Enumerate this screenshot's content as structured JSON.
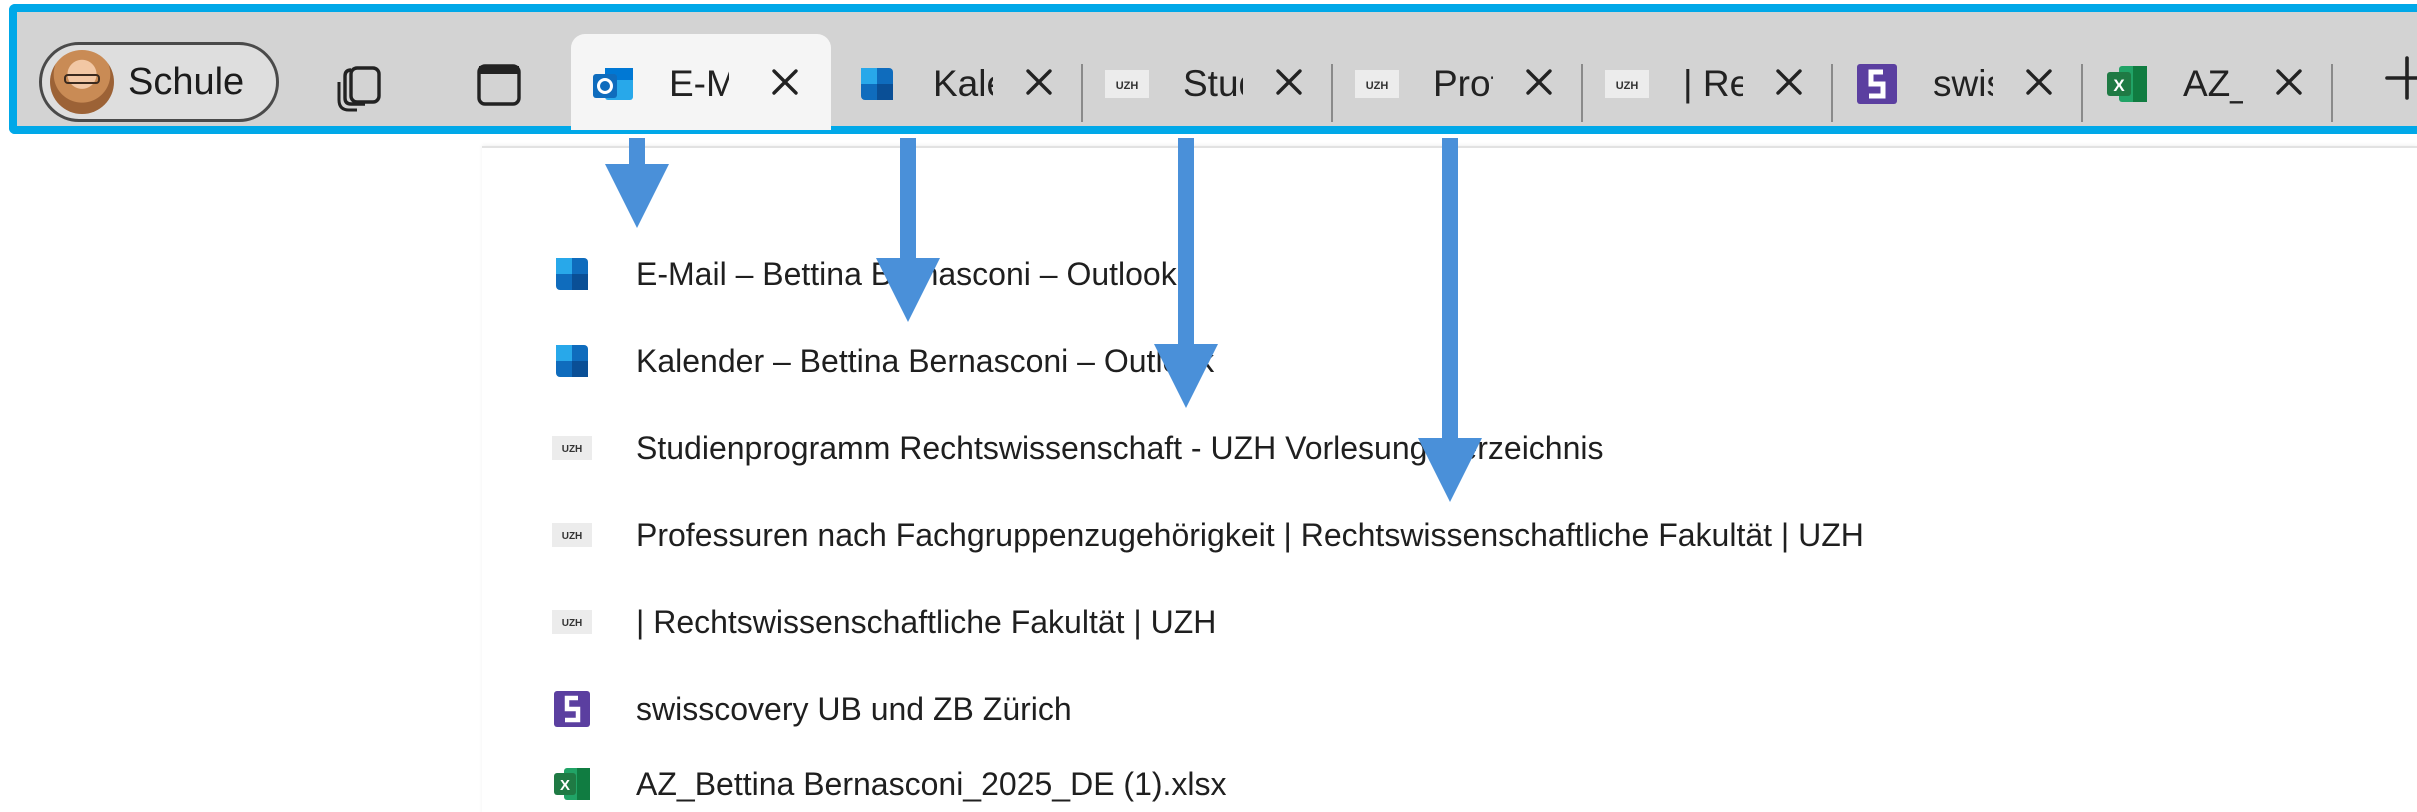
{
  "profile": {
    "label": "Schule",
    "avatar_icon": "profile-avatar"
  },
  "toolbar": {
    "collections_icon": "collections-icon",
    "tab_actions_icon": "tab-actions-icon",
    "new_tab_icon": "plus-icon"
  },
  "tabs": [
    {
      "title": "E-Mail",
      "favicon": "outlook-mail-icon",
      "active": true
    },
    {
      "title": "Kalender",
      "favicon": "outlook-calendar-icon",
      "active": false
    },
    {
      "title": "Studienprogramm",
      "favicon": "uzh-icon",
      "active": false
    },
    {
      "title": "Professuren",
      "favicon": "uzh-icon",
      "active": false
    },
    {
      "title": "| Rechtswissenschaftliche",
      "favicon": "uzh-icon",
      "active": false
    },
    {
      "title": "swisscovery",
      "favicon": "swisscovery-icon",
      "active": false
    },
    {
      "title": "AZ_Bettina",
      "favicon": "excel-icon",
      "active": false
    }
  ],
  "dropdown": {
    "items": [
      {
        "label": "E-Mail – Bettina Bernasconi – Outlook",
        "icon": "outlook-icon"
      },
      {
        "label": "Kalender – Bettina Bernasconi – Outlook",
        "icon": "outlook-icon"
      },
      {
        "label": "Studienprogramm Rechtswissenschaft - UZH Vorlesungsverzeichnis",
        "icon": "uzh-icon"
      },
      {
        "label": "Professuren nach Fachgruppenzugehörigkeit | Rechtswissenschaftliche Fakultät | UZH",
        "icon": "uzh-icon"
      },
      {
        "label": "| Rechtswissenschaftliche Fakultät | UZH",
        "icon": "uzh-icon"
      },
      {
        "label": "swisscovery UB und ZB Zürich",
        "icon": "swisscovery-icon"
      },
      {
        "label": "AZ_Bettina Bernasconi_2025_DE (1).xlsx",
        "icon": "excel-icon"
      }
    ]
  },
  "favicon_text": {
    "uzh": "UZH",
    "excel": "X"
  },
  "colors": {
    "highlight_border": "#00a8e8",
    "arrow": "#4a90d9",
    "tab_strip": "#d3d3d3",
    "swisscovery": "#5b3fa0",
    "excel": "#1f7a44",
    "outlook": "#0f6cbd"
  }
}
